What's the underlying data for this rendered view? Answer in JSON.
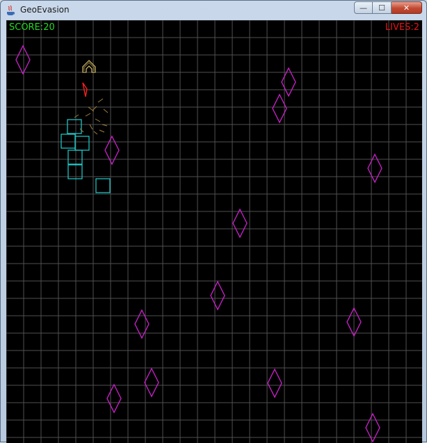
{
  "window": {
    "title": "GeoEvasion",
    "controls": {
      "minimize": "—",
      "maximize": "☐",
      "close": "✕"
    }
  },
  "hud": {
    "score": "SCORE:20",
    "lives": "LIVES:2"
  },
  "colors": {
    "background": "#000000",
    "grid": "#505050",
    "diamond": "#d020d0",
    "square": "#20d0d0",
    "player": "#c8b060",
    "bullet": "#ff2020",
    "score": "#22dd22",
    "lives": "#ee1111"
  },
  "icons": [
    "java-app-icon",
    "minimize-icon",
    "maximize-icon",
    "close-icon"
  ]
}
